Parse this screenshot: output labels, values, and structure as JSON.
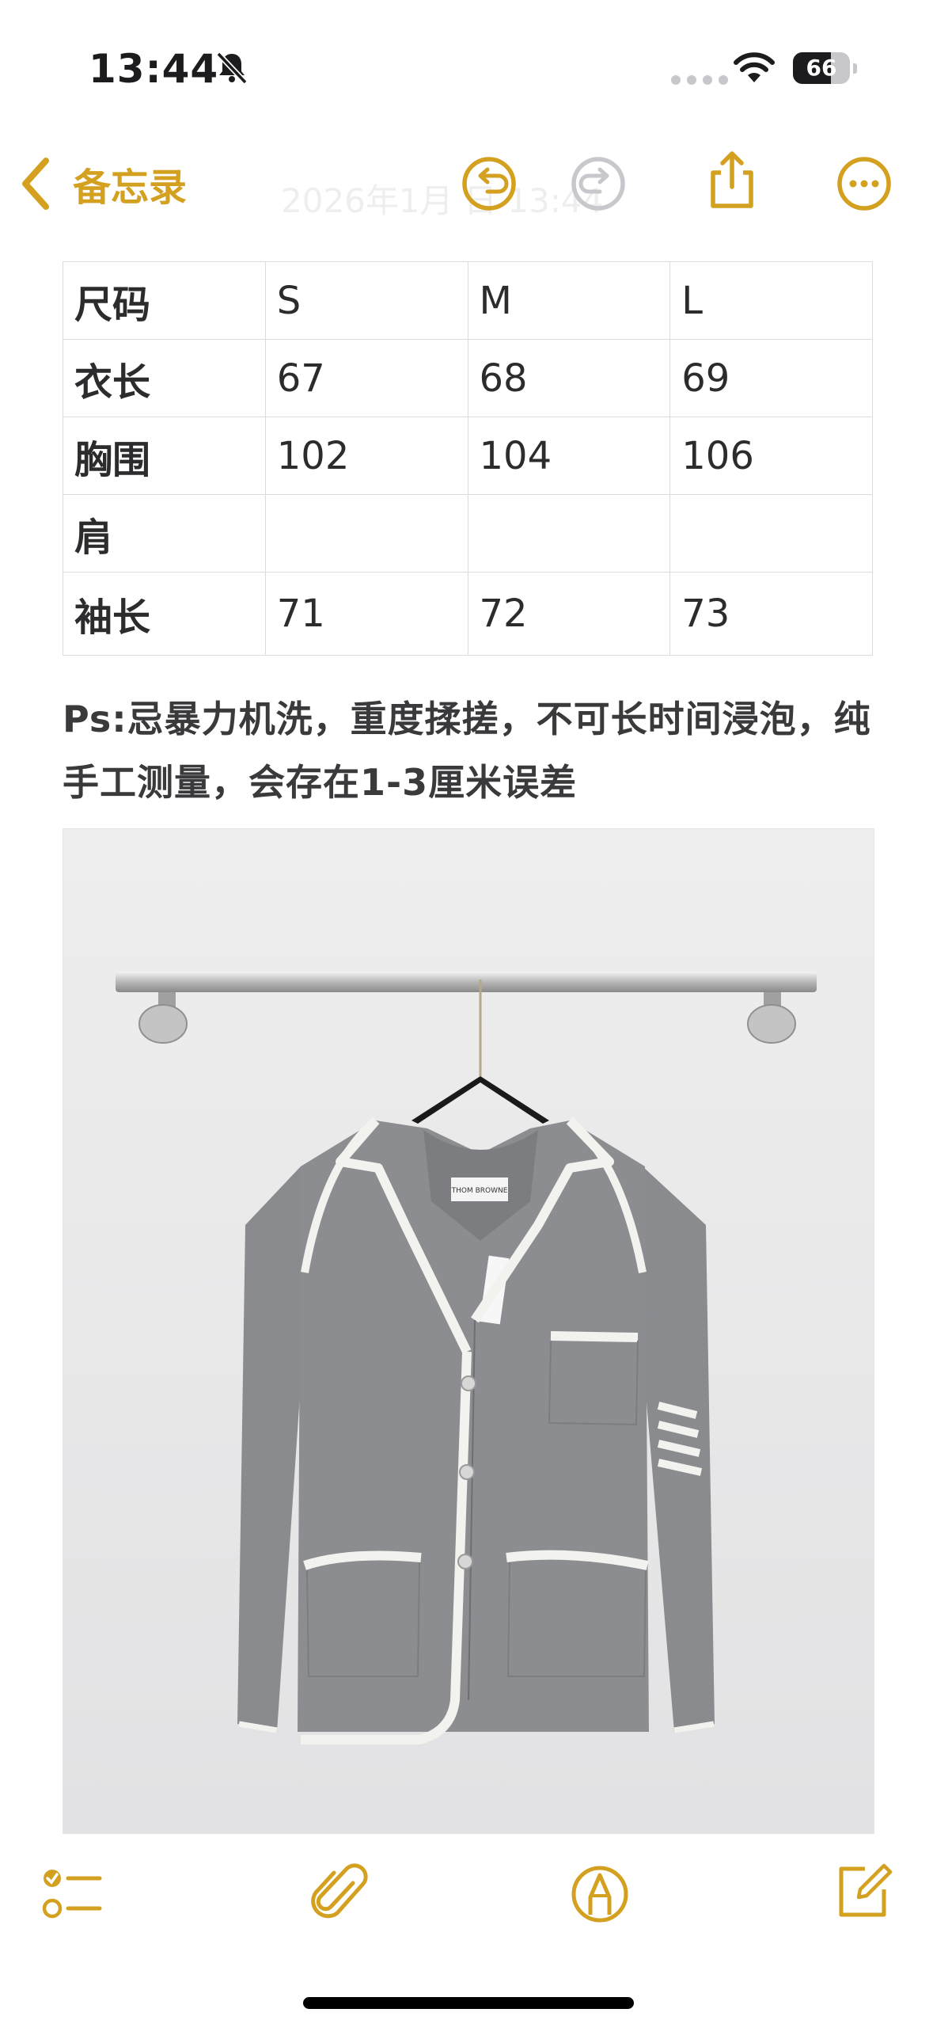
{
  "status_bar": {
    "time": "13:44",
    "battery_level": "66",
    "battery_fraction": 0.66,
    "icons": [
      "bell-slash-icon",
      "signal-icon",
      "wifi-icon",
      "battery-icon"
    ]
  },
  "nav": {
    "back_label": "备忘录",
    "faded_title": "2026年1月  日 13:44",
    "accent_color": "#d4a020",
    "icons": [
      "chevron-left-icon",
      "undo-icon",
      "redo-icon",
      "share-icon",
      "more-icon"
    ]
  },
  "size_table": {
    "header": [
      "尺码",
      "S",
      "M",
      "L"
    ],
    "rows": [
      [
        "衣长",
        "67",
        "68",
        "69"
      ],
      [
        "胸围",
        "102",
        "104",
        "106"
      ],
      [
        "肩",
        "",
        "",
        ""
      ],
      [
        "袖长",
        "71",
        "72",
        "73"
      ]
    ]
  },
  "note": {
    "text": "Ps:忌暴力机洗，重度揉搓，不可长时间浸泡，纯手工测量，会存在1-3厘米误差"
  },
  "photo": {
    "label_text": "THOM BROWNE"
  },
  "toolbar": {
    "icons": [
      "checklist-icon",
      "paperclip-icon",
      "markup-pen-icon",
      "compose-icon"
    ]
  }
}
